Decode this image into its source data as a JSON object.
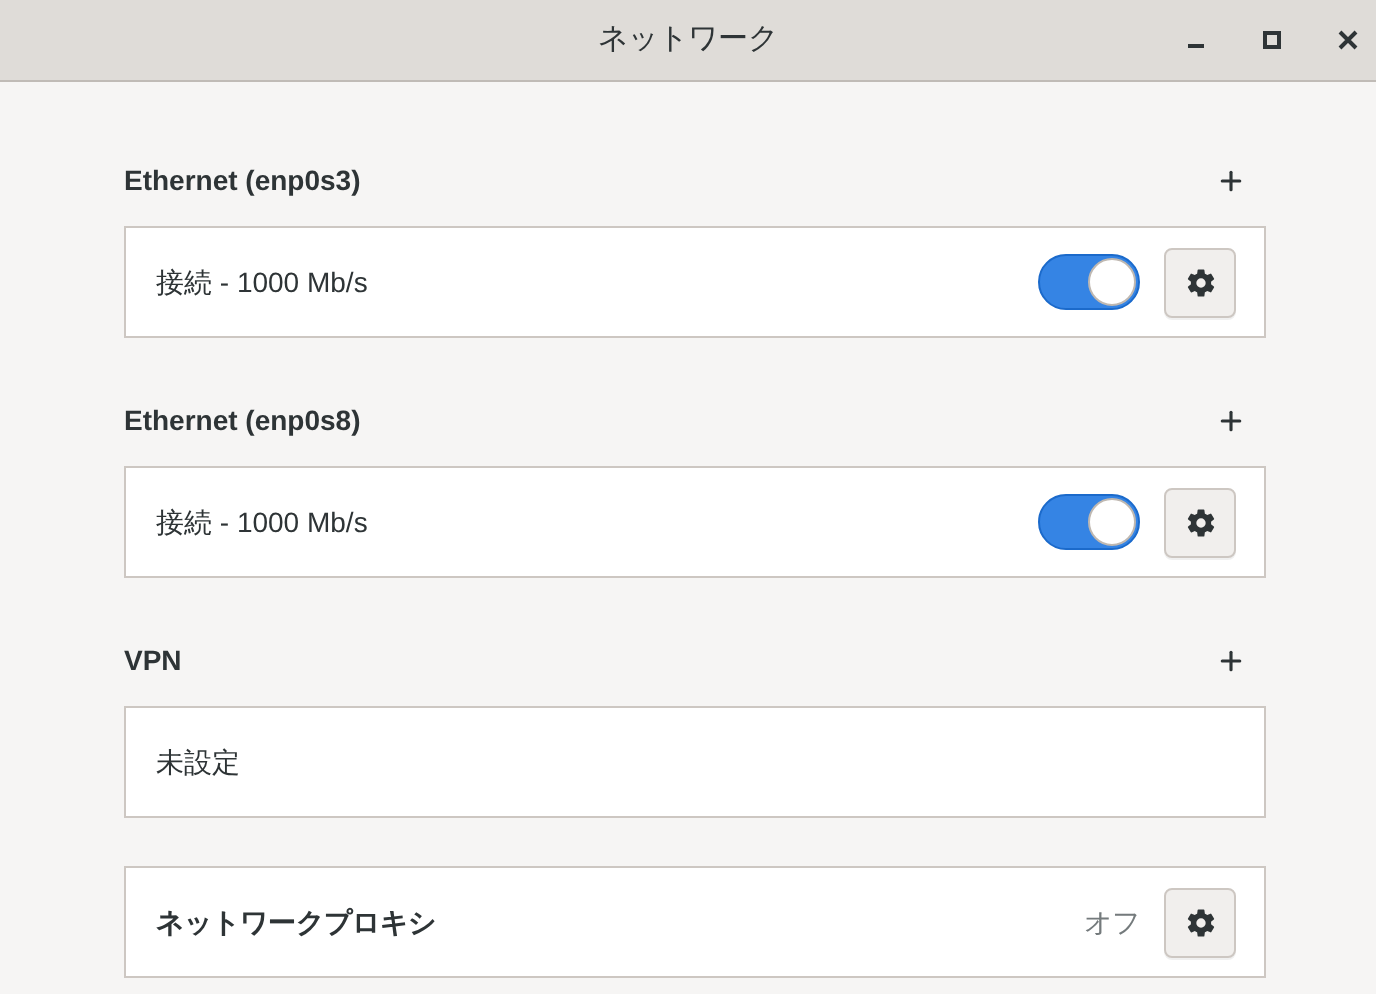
{
  "window": {
    "title": "ネットワーク",
    "controls": [
      {
        "kind": "minimize"
      },
      {
        "kind": "maximize"
      },
      {
        "kind": "close"
      }
    ]
  },
  "sections": [
    {
      "title": "Ethernet (enp0s3)",
      "rows": [
        {
          "kind": "toggle",
          "label": "接続 - 1000 Mb/s",
          "on": true
        }
      ]
    },
    {
      "title": "Ethernet (enp0s8)",
      "rows": [
        {
          "kind": "toggle",
          "label": "接続 - 1000 Mb/s",
          "on": true
        }
      ]
    },
    {
      "title": "VPN",
      "rows": [
        {
          "kind": "text",
          "label": "未設定"
        }
      ]
    }
  ],
  "proxy": {
    "label": "ネットワークプロキシ",
    "status": "オフ"
  }
}
